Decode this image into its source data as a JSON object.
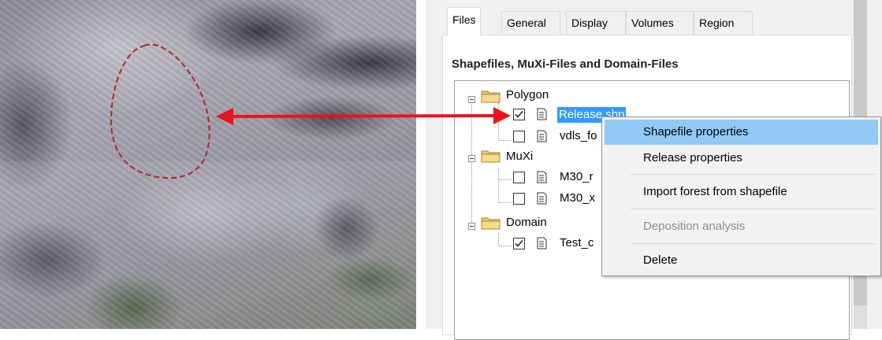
{
  "tabs": [
    {
      "label": "Files",
      "active": true
    },
    {
      "label": "General"
    },
    {
      "label": "Display"
    },
    {
      "label": "Volumes"
    },
    {
      "label": "Region"
    }
  ],
  "section_title": "Shapefiles, MuXi-Files and Domain-Files",
  "tree": {
    "groups": [
      {
        "label": "Polygon",
        "children": [
          {
            "label": "Release.shp",
            "checked": true,
            "selected": true
          },
          {
            "label": "vdls_fo",
            "checked": false
          }
        ]
      },
      {
        "label": "MuXi",
        "children": [
          {
            "label": "M30_r",
            "checked": false
          },
          {
            "label": "M30_x",
            "checked": false
          }
        ]
      },
      {
        "label": "Domain",
        "children": [
          {
            "label": "Test_c",
            "checked": true
          }
        ]
      }
    ]
  },
  "context_menu": {
    "items": [
      {
        "label": "Shapefile properties",
        "highlighted": true
      },
      {
        "label": "Release properties"
      },
      {
        "label": "Import forest from shapefile"
      },
      {
        "label": "Deposition analysis",
        "disabled": true
      },
      {
        "label": "Delete"
      }
    ]
  },
  "colors": {
    "selection": "#3399ff",
    "menu_highlight": "#91c9f7",
    "arrow": "#e8141b",
    "outline_dashed": "#b03030"
  },
  "icons": {
    "folder": "folder-icon",
    "file": "file-icon",
    "expander": "collapse-icon",
    "check": "checkmark-icon"
  }
}
